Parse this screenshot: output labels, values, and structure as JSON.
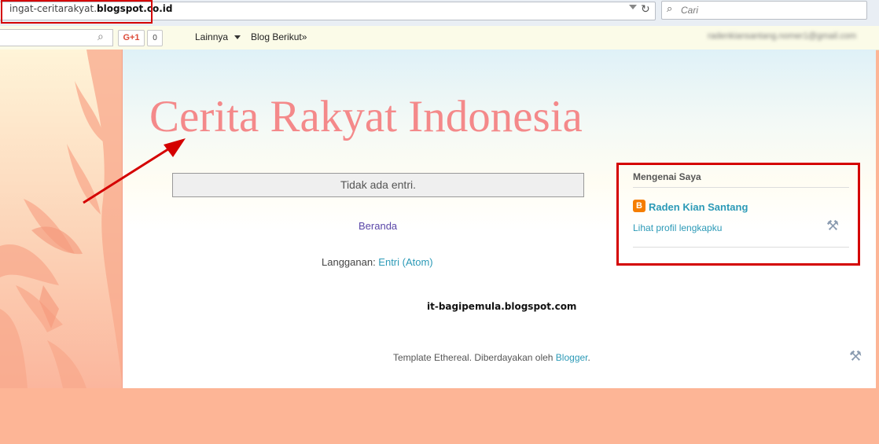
{
  "browser": {
    "url_prefix": "ingat-ceritarakyat.",
    "url_domain": "blogspot.co.id",
    "search_placeholder": "Cari",
    "icons": [
      "lock-icon",
      "dropdown-icon",
      "reload-icon",
      "search-icon"
    ]
  },
  "navbar": {
    "gplus_label": "G+1",
    "gplus_count": "0",
    "more_label": "Lainnya",
    "next_blog_label": "Blog Berikut»",
    "user_email": "radenkiansantang.nomer1@gmail.com"
  },
  "blog": {
    "title": "Cerita Rakyat Indonesia",
    "no_entries": "Tidak ada entri.",
    "home_link": "Beranda",
    "subscription_label": "Langganan: ",
    "subscription_link": "Entri (Atom)",
    "watermark": "it-bagipemula.blogspot.com",
    "footer_text": "Template Ethereal. Diberdayakan oleh ",
    "footer_link": "Blogger",
    "footer_end": "."
  },
  "about": {
    "title": "Mengenai Saya",
    "name": "Raden Kian Santang",
    "profile_link": "Lihat profil lengkapku"
  },
  "colors": {
    "title": "#f4898a",
    "link": "#2c9ab7",
    "highlight": "#d40000",
    "background": "#fdb596"
  }
}
